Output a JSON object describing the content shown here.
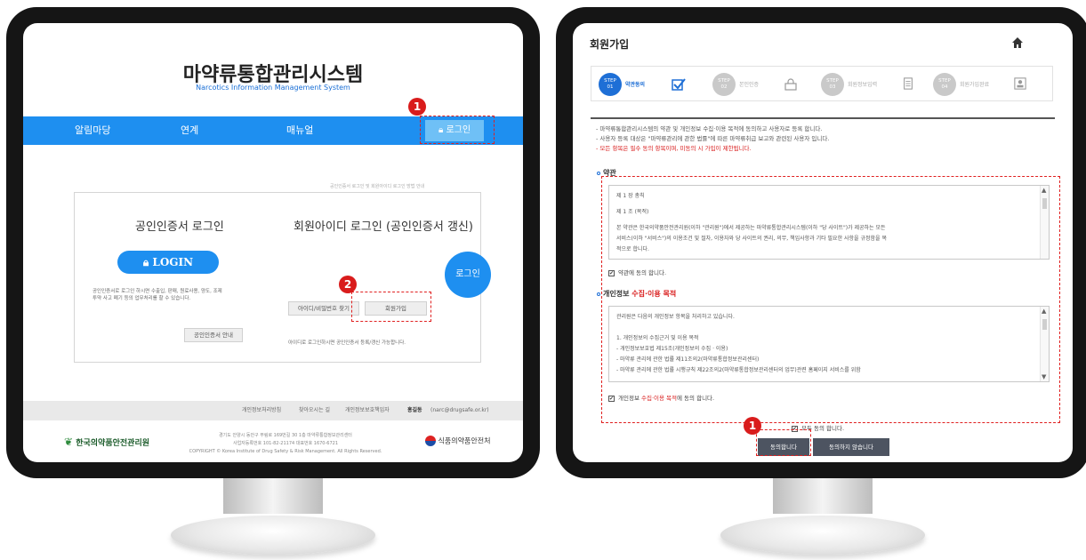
{
  "left": {
    "system_title": "마약류통합관리시스템",
    "system_subtitle": "Narcotics Information Management System",
    "nav": {
      "items": [
        "알림마당",
        "연계",
        "매뉴얼"
      ],
      "login": "로그인"
    },
    "badges": [
      "1",
      "2"
    ],
    "top_note": "공인인증서 로그인 및 회원아이디 로그인 방법 안내",
    "cert_login": {
      "heading": "공인인증서 로그인",
      "button": "LOGIN",
      "desc": [
        "공인인증서로 로그인 하시면 수출입, 판매, 원료사용, 양도, 조제",
        "투약 사고 폐기 등의 업무처리를 할 수 있습니다."
      ],
      "guide_button": "공인인증서 안내"
    },
    "member_login": {
      "heading": "회원아이디 로그인 (공인인증서 갱신)",
      "login_button": "로그인",
      "find_button": "아이디/비밀번호 찾기",
      "join_button": "회원가입",
      "note": "아이디로 로그인하시면 공인인증서 등록/갱신 가능합니다."
    },
    "footer": {
      "links": [
        "개인정보처리방침",
        "찾아오시는 길",
        "개인정보보호책임자"
      ],
      "manager_name": "홍길동",
      "manager_email": "(narc@drugsafe.or.kr)",
      "address_lines": [
        "경기도 안양시 동안구 부림로 169번길 30 1층 마약류통합정보관리센터",
        "사업자등록번호 101-82-21174  대표번호 1670-6721",
        "COPYRIGHT © Korea Institute of Drug Safety & Risk Management. All Rights Reserved."
      ],
      "org_left": "한국의약품안전관리원",
      "org_right": "식품의약품안전처"
    }
  },
  "right": {
    "title": "회원가입",
    "steps": [
      {
        "no": "01",
        "label": "약관동의"
      },
      {
        "no": "02",
        "label": "본인인증"
      },
      {
        "no": "03",
        "label": "회원정보입력"
      },
      {
        "no": "04",
        "label": "회원가입완료"
      }
    ],
    "step_prefix": "STEP",
    "notices": [
      "- 마약류통합관리시스템의 약관 및 개인정보 수집·이용 목적에 동의하고 사용자로 등록 합니다.",
      "- 사용자 등록 대상은 \"마약류관리에 관한 법률\"에 따른 마약류취급 보고와 관련된 사용자 입니다.",
      "- 모든 항목은 필수 동의 항목이며, 미동의 시 가입이 제한됩니다."
    ],
    "terms": {
      "heading": "약관",
      "lines": [
        "제 1 장 총칙",
        "제 1 조 (목적)",
        "본 약관은 한국의약품안전관리원(이하 \"관리원\")에서 제공하는 마약류통합관리시스템(이하 \"당 사이트\")가 제공하는 모든",
        "서비스(이하 \"서비스\")의 이용조건 및 절차, 이용자와 당 사이트의 권리, 의무, 책임사항과 기타 필요한 사항을 규정함을 목",
        "적으로 합니다."
      ],
      "agree": "약관에 동의 합니다."
    },
    "privacy": {
      "heading_plain": "개인정보",
      "heading_red": "수집·이용 목적",
      "lines": [
        "관리원은 다음의 개인정보 항목을 처리하고 있습니다.",
        "1. 개인정보의 수집근거 및 이용 목적",
        "- 개인정보보호법 제15조(개인정보의 수집 · 이용)",
        "- 마약류 관리에 관한 법률 제11조의2(마약류통합정보관리센터)",
        "- 마약류 관리에 관한 법률 시행규칙 제22조의2(마약류통합정보관리센터의 업무)관련 홈페이지 서비스를 위함"
      ],
      "agree_plain": "개인정보",
      "agree_red": "수집·이용 목적",
      "agree_suffix": "에 동의 합니다."
    },
    "all_agree": "모두 동의 합니다.",
    "badge": "1",
    "agree_button": "동의합니다",
    "disagree_button": "동의하지 않습니다"
  },
  "colors": {
    "primary_blue": "#1e8ff0",
    "badge_red": "#d91c1c",
    "dark_button": "#4d5461",
    "monitor_bezel": "#151515"
  }
}
